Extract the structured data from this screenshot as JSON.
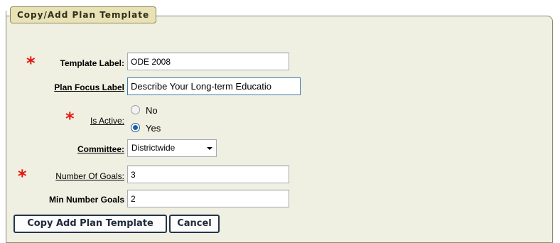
{
  "panel": {
    "title": "Copy/Add Plan Template"
  },
  "form": {
    "template_label": {
      "label": "Template Label:",
      "value": "ODE 2008",
      "required": true
    },
    "plan_focus_label": {
      "label": "Plan Focus Label",
      "value": "Describe Your Long-term Educatio"
    },
    "is_active": {
      "label": "Is Active:",
      "required": true,
      "options": [
        "No",
        "Yes"
      ],
      "selected": "Yes"
    },
    "committee": {
      "label": "Committee:",
      "value": "Districtwide"
    },
    "number_of_goals": {
      "label": "Number Of Goals:",
      "value": "3",
      "required": true
    },
    "min_number_goals": {
      "label": "Min Number Goals",
      "value": "2"
    }
  },
  "buttons": {
    "copy_add": "Copy Add Plan Template",
    "cancel": "Cancel"
  },
  "colors": {
    "panel_bg": "#efefe2",
    "legend_bg": "#e8e2b4",
    "required": "#e8140d"
  }
}
